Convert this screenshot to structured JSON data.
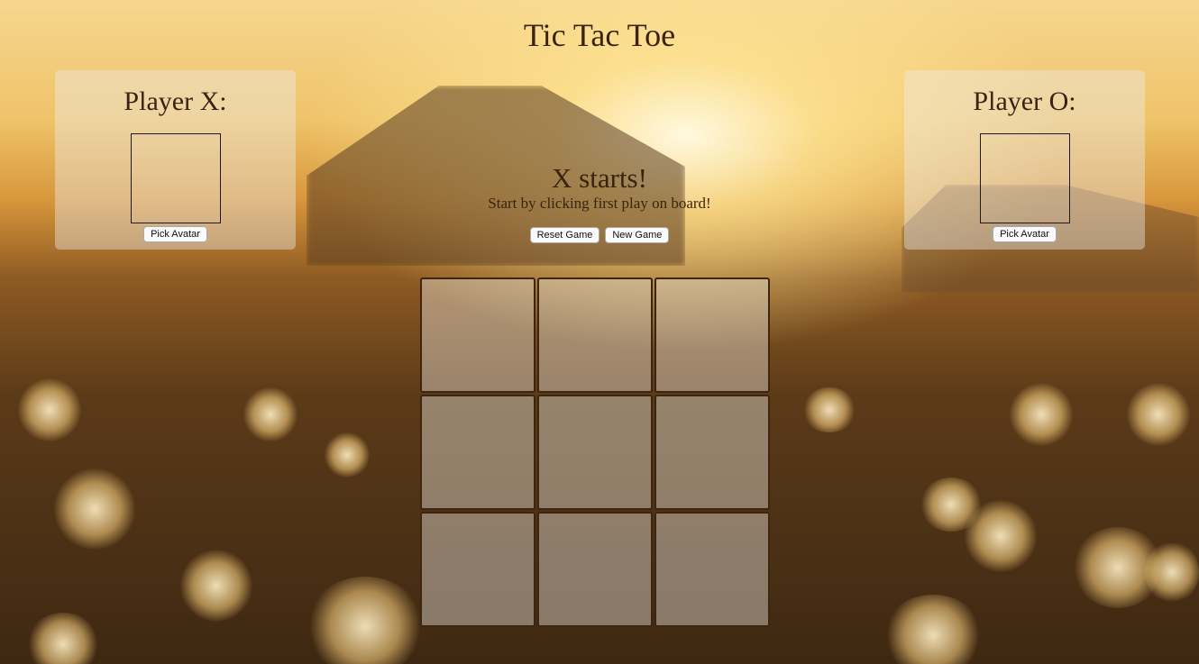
{
  "game": {
    "title": "Tic Tac Toe",
    "status": "X starts!",
    "instruction": "Start by clicking first play on board!"
  },
  "players": {
    "x": {
      "label": "Player X:",
      "avatar_button": "Pick Avatar"
    },
    "o": {
      "label": "Player O:",
      "avatar_button": "Pick Avatar"
    }
  },
  "controls": {
    "reset_label": "Reset Game",
    "new_label": "New Game"
  },
  "board": {
    "cells": [
      "",
      "",
      "",
      "",
      "",
      "",
      "",
      "",
      ""
    ]
  },
  "colors": {
    "text": "#3a230f",
    "cell_border": "#3d2510"
  }
}
